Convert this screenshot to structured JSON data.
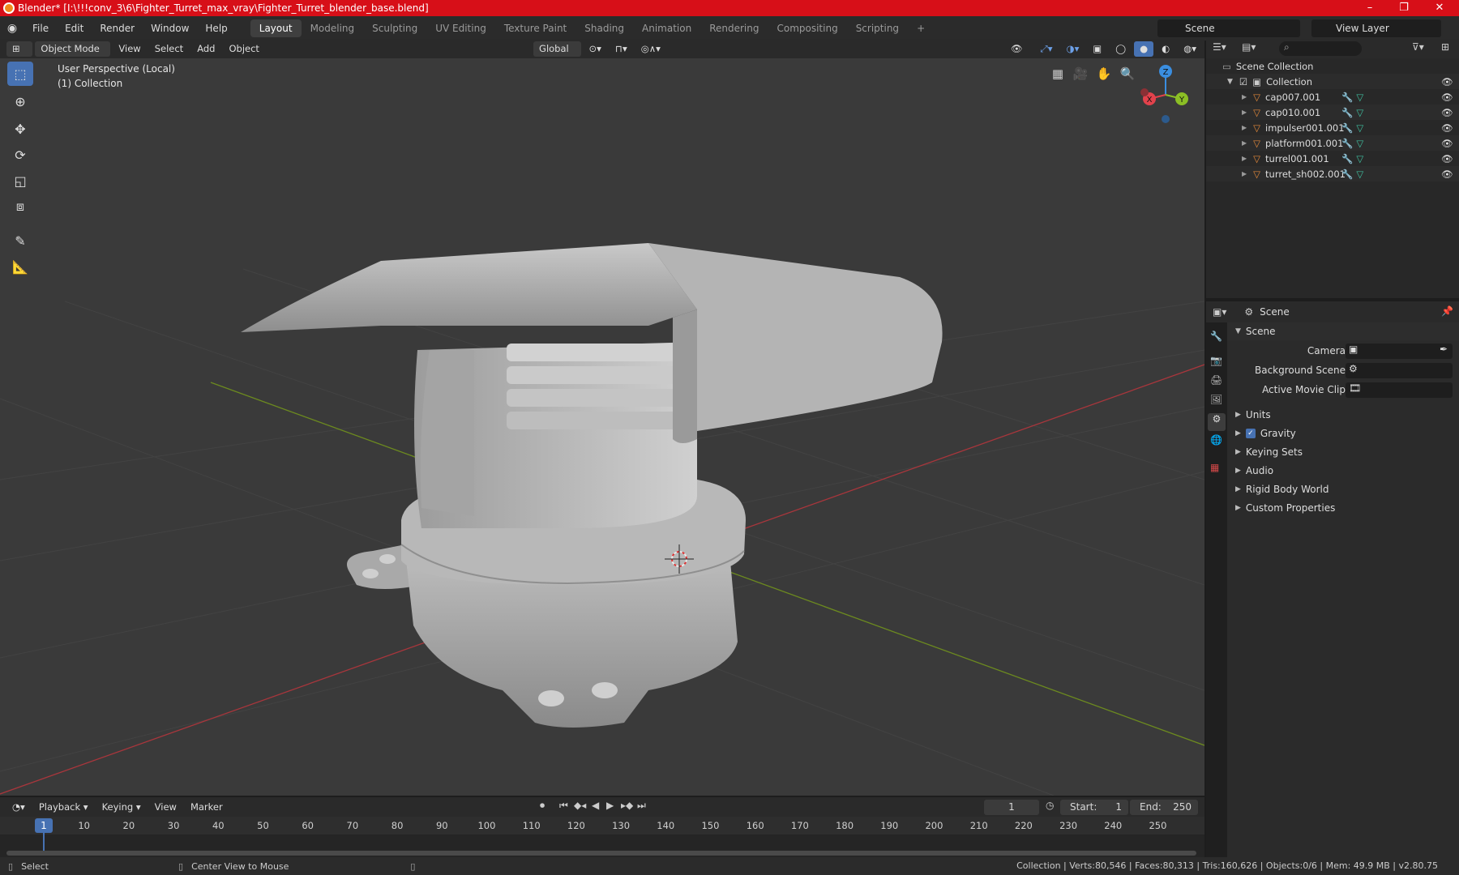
{
  "titlebar": {
    "title": "Blender* [I:\\!!!conv_3\\6\\Fighter_Turret_max_vray\\Fighter_Turret_blender_base.blend]",
    "minimize": "–",
    "maximize": "❐",
    "close": "✕"
  },
  "menu": {
    "file": "File",
    "edit": "Edit",
    "render": "Render",
    "window": "Window",
    "help": "Help"
  },
  "workspaces": [
    "Layout",
    "Modeling",
    "Sculpting",
    "UV Editing",
    "Texture Paint",
    "Shading",
    "Animation",
    "Rendering",
    "Compositing",
    "Scripting"
  ],
  "workspace_add": "+",
  "scene_selector": {
    "value": "Scene"
  },
  "view_layer_selector": {
    "value": "View Layer"
  },
  "viewport_header": {
    "mode": "Object Mode",
    "view": "View",
    "select": "Select",
    "add": "Add",
    "object": "Object",
    "orientation": "Global"
  },
  "viewport": {
    "perspective": "User Perspective (Local)",
    "collection": "(1) Collection"
  },
  "gizmo": {
    "z": "Z",
    "y": "Y",
    "x": "X"
  },
  "outliner": {
    "root": "Scene Collection",
    "collection": "Collection",
    "objects": [
      "cap007.001",
      "cap010.001",
      "impulser001.001",
      "platform001.001",
      "turrel001.001",
      "turret_sh002.001"
    ]
  },
  "properties": {
    "header": "Scene",
    "panel": "Scene",
    "camera_label": "Camera",
    "background_scene_label": "Background Scene",
    "movie_clip_label": "Active Movie Clip",
    "subpanels": [
      "Units",
      "Gravity",
      "Keying Sets",
      "Audio",
      "Rigid Body World",
      "Custom Properties"
    ]
  },
  "timeline": {
    "playback": "Playback",
    "keying": "Keying",
    "view": "View",
    "marker": "Marker",
    "current_frame": "1",
    "start_label": "Start:",
    "start": "1",
    "end_label": "End:",
    "end": "250",
    "ruler": [
      "10",
      "20",
      "30",
      "40",
      "50",
      "60",
      "70",
      "80",
      "90",
      "100",
      "110",
      "120",
      "130",
      "140",
      "150",
      "160",
      "170",
      "180",
      "190",
      "200",
      "210",
      "220",
      "230",
      "240",
      "250"
    ],
    "ruler_current": "1"
  },
  "statusbar": {
    "select": "Select",
    "center": "Center View to Mouse",
    "stats": "Collection | Verts:80,546 | Faces:80,313 | Tris:160,626 | Objects:0/6 | Mem: 49.9 MB | v2.80.75"
  },
  "colors": {
    "accent": "#4772b3",
    "titlebar": "#d70f18",
    "x_axis": "#e2424c",
    "y_axis": "#8bbf25",
    "z_axis": "#3a8ee0"
  }
}
